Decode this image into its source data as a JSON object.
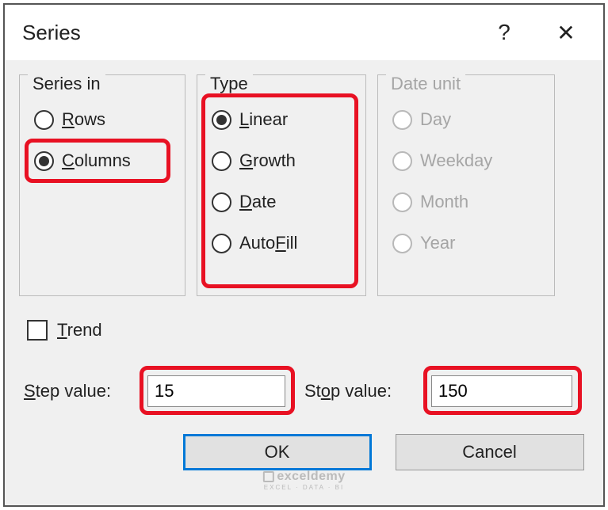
{
  "title": "Series",
  "help_glyph": "?",
  "close_glyph": "✕",
  "groups": {
    "series_in": {
      "legend": "Series in",
      "rows": {
        "label_pre": "",
        "ul": "R",
        "label_post": "ows",
        "selected": false
      },
      "columns": {
        "label_pre": "",
        "ul": "C",
        "label_post": "olumns",
        "selected": true
      }
    },
    "type": {
      "legend": "Type",
      "linear": {
        "label_pre": "",
        "ul": "L",
        "label_post": "inear",
        "selected": true
      },
      "growth": {
        "label_pre": "",
        "ul": "G",
        "label_post": "rowth",
        "selected": false
      },
      "date": {
        "label_pre": "",
        "ul": "D",
        "label_post": "ate",
        "selected": false
      },
      "autofill": {
        "label_pre": "Auto",
        "ul": "F",
        "label_post": "ill",
        "selected": false
      }
    },
    "date_unit": {
      "legend": "Date unit",
      "day": {
        "label": "Day"
      },
      "weekday": {
        "label": "Weekday"
      },
      "month": {
        "label": "Month"
      },
      "year": {
        "label": "Year"
      }
    }
  },
  "trend": {
    "label_ul": "T",
    "label_post": "rend",
    "checked": false
  },
  "step": {
    "label_ul": "S",
    "label_post": "tep value:",
    "value": "15"
  },
  "stop": {
    "label_pre": "St",
    "label_ul": "o",
    "label_post": "p value:",
    "value": "150"
  },
  "buttons": {
    "ok": "OK",
    "cancel": "Cancel"
  },
  "watermark": {
    "name": "exceldemy",
    "sub": "EXCEL · DATA · BI"
  }
}
